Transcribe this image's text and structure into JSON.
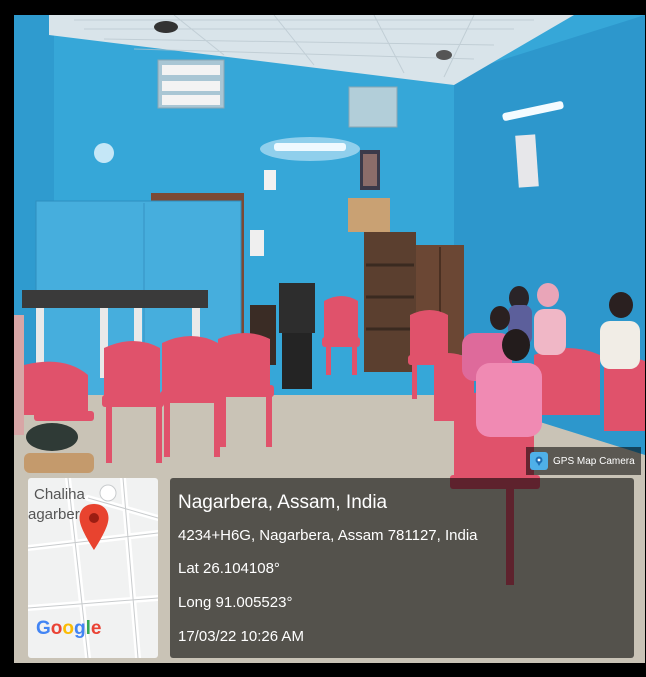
{
  "badge": {
    "label": "GPS Map Camera",
    "icon": "map-pin-icon"
  },
  "map": {
    "place_line_1": "Chaliha",
    "place_line_2": "agarber",
    "logo": "Google",
    "logo_colors": [
      "#4285F4",
      "#EA4335",
      "#FBBC05",
      "#4285F4",
      "#34A853",
      "#EA4335"
    ],
    "marker_color": "#e8432f"
  },
  "info": {
    "title": "Nagarbera, Assam, India",
    "address": "4234+H6G, Nagarbera, Assam 781127, India",
    "latitude": "Lat 26.104108°",
    "longitude": "Long 91.005523°",
    "datetime": "17/03/22 10:26 AM"
  },
  "colors": {
    "wall": "#36a7d8",
    "chair": "#e0526b",
    "floor": "#c9c3b6"
  }
}
